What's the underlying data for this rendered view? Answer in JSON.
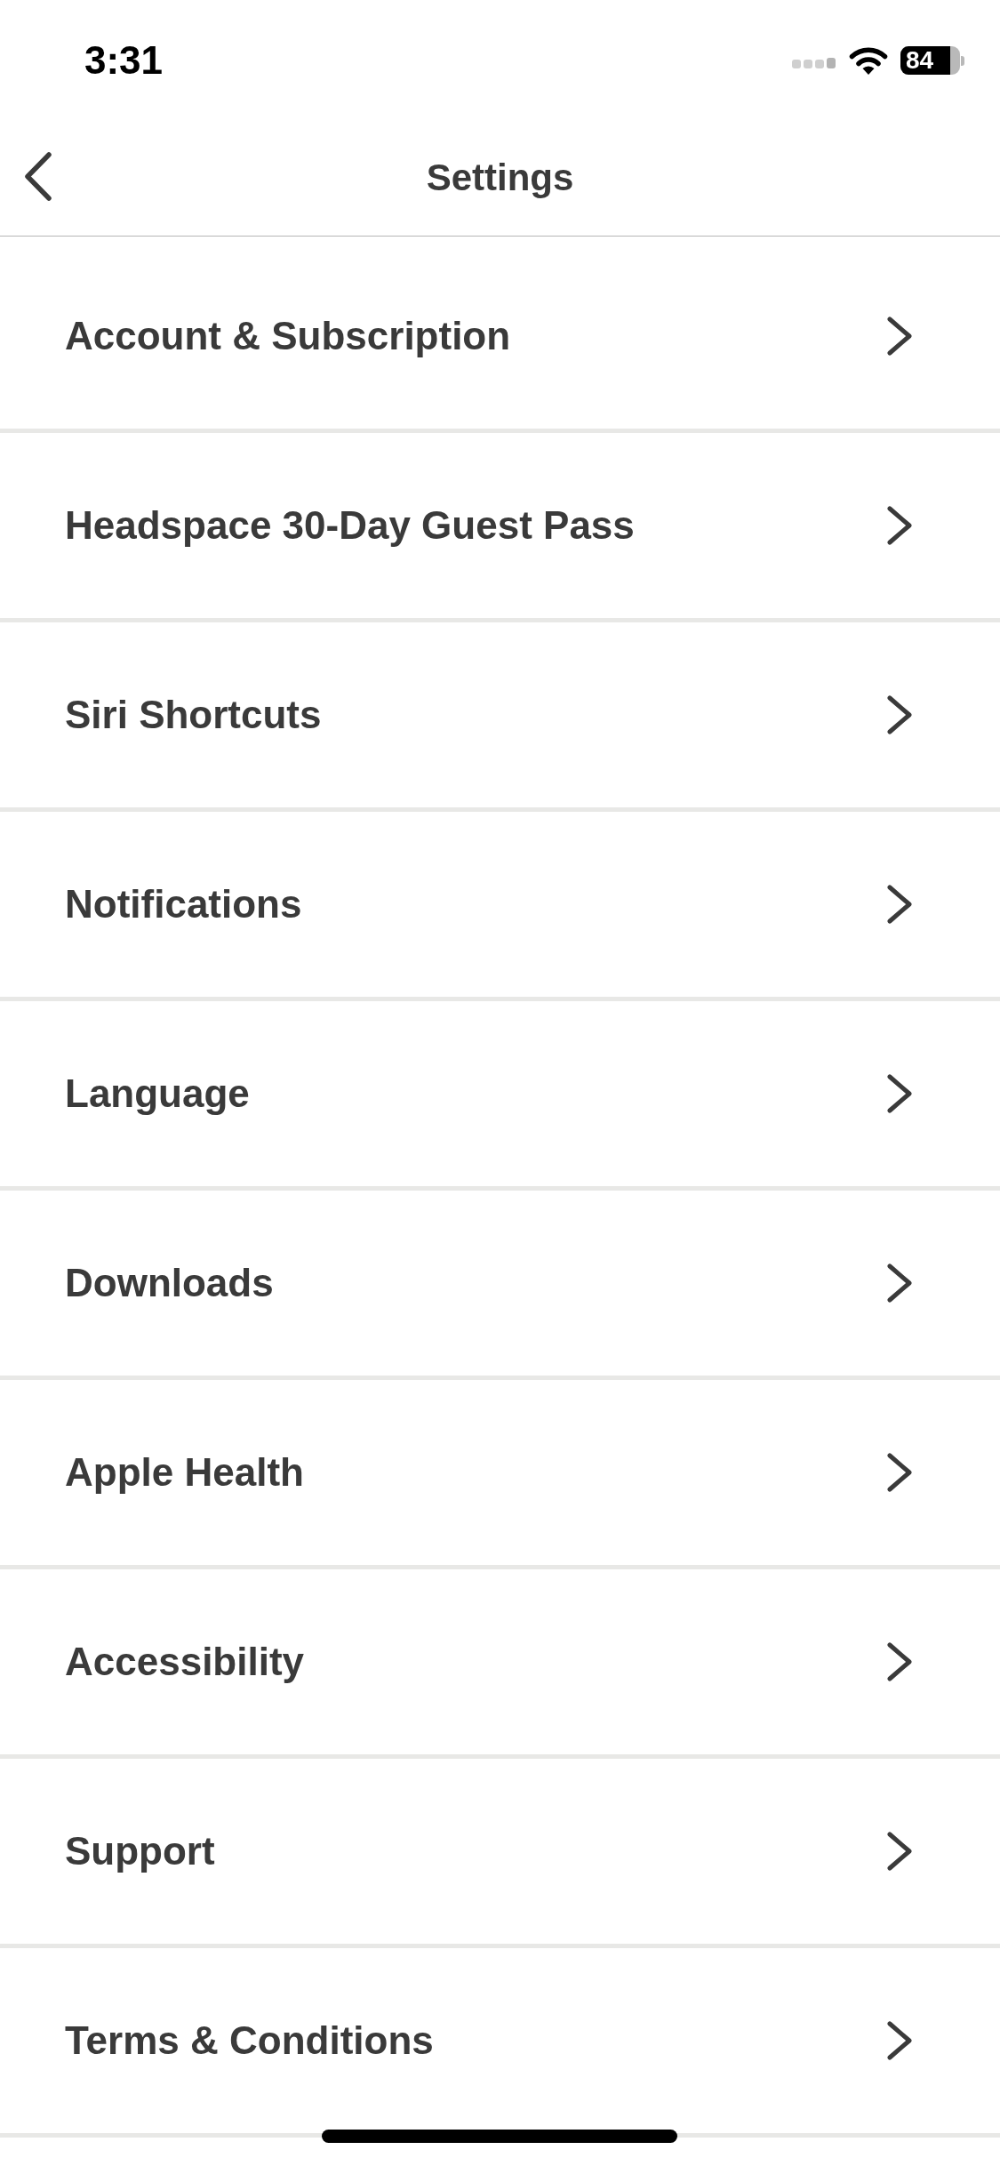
{
  "status_bar": {
    "time": "3:31",
    "battery": "84"
  },
  "header": {
    "title": "Settings"
  },
  "menu_items": [
    {
      "label": "Account & Subscription"
    },
    {
      "label": "Headspace 30-Day Guest Pass"
    },
    {
      "label": "Siri Shortcuts"
    },
    {
      "label": "Notifications"
    },
    {
      "label": "Language"
    },
    {
      "label": "Downloads"
    },
    {
      "label": "Apple Health"
    },
    {
      "label": "Accessibility"
    },
    {
      "label": "Support"
    },
    {
      "label": "Terms & Conditions"
    }
  ]
}
